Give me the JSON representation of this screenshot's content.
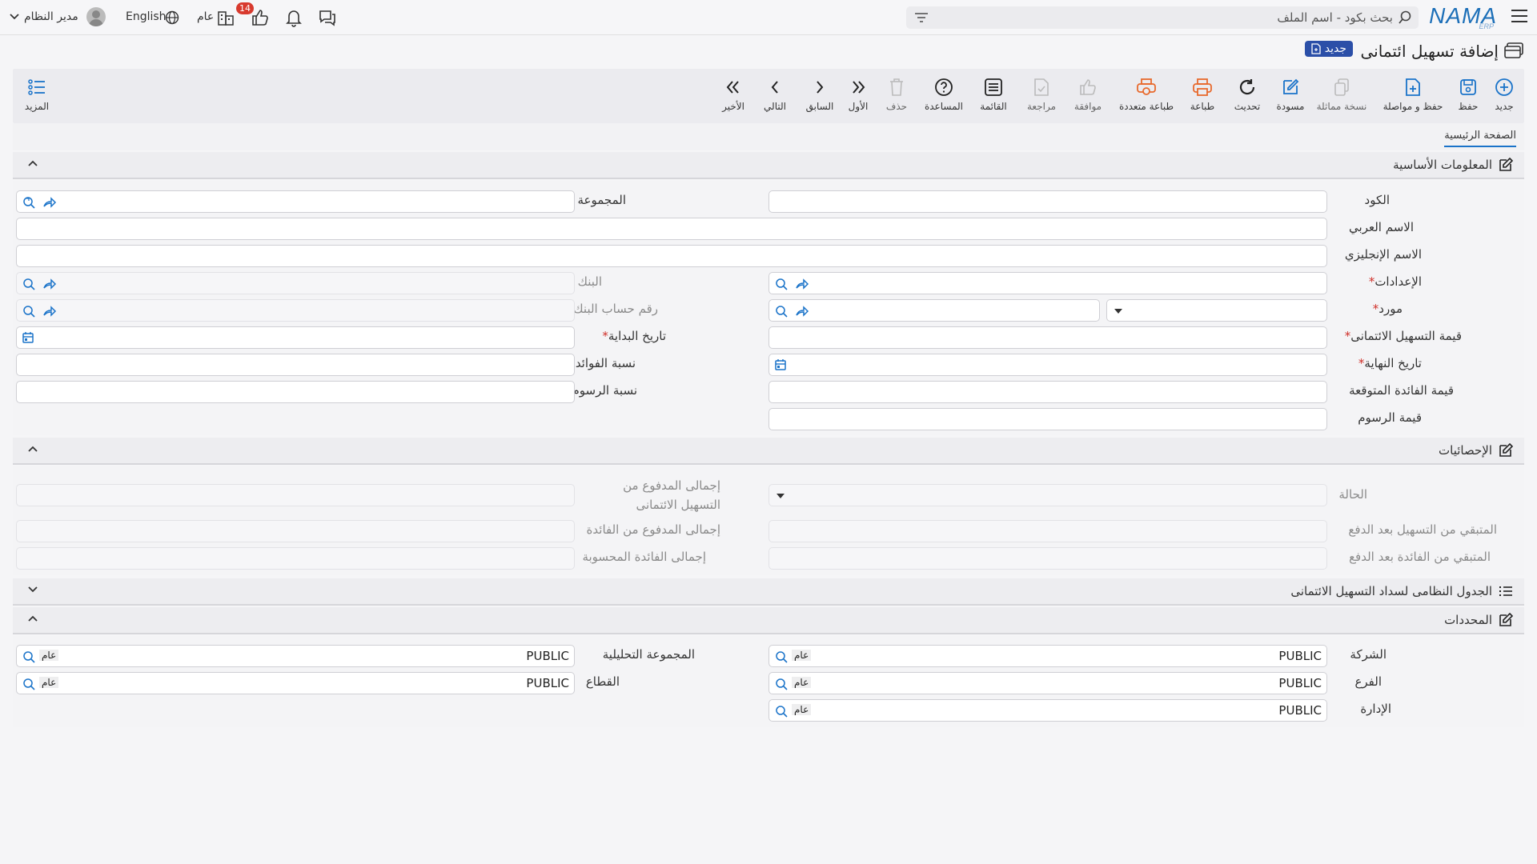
{
  "header": {
    "search_placeholder": "بحث بكود - اسم الملف",
    "brand": "NAMA",
    "brand_sub": "ERP",
    "language": "English",
    "user": "مدير النظام",
    "scope": "عام",
    "notification_count": "14"
  },
  "page": {
    "title": "إضافة تسهيل ائتمانى",
    "badge": "جديد"
  },
  "toolbar": {
    "new": "جديد",
    "save": "حفظ",
    "save_continue": "حفظ و مواصلة",
    "duplicate": "نسخة مماثلة",
    "draft": "مسودة",
    "refresh": "تحديث",
    "print": "طباعة",
    "multi_print": "طباعة متعددة",
    "approve": "موافقة",
    "review": "مراجعة",
    "list": "القائمة",
    "help": "المساعدة",
    "delete": "حذف",
    "first": "الأول",
    "previous": "السابق",
    "next": "التالي",
    "last": "الأخير",
    "more": "المزيد"
  },
  "tabs": {
    "main": "الصفحة الرئيسية"
  },
  "sections": {
    "basic": "المعلومات الأساسية",
    "stats": "الإحصائيات",
    "schedule": "الجدول النظامى لسداد التسهيل الائتمانى",
    "dimensions": "المحددات"
  },
  "basic": {
    "code": "الكود",
    "group": "المجموعة",
    "arabic_name": "الاسم العربي",
    "english_name": "الاسم الإنجليزي",
    "settings": "الإعدادات",
    "bank": "البنك",
    "supplier": "مورد",
    "bank_account": "رقم حساب البنك",
    "credit_value": "قيمة التسهيل الائتمانى",
    "start_date": "تاريخ البداية",
    "end_date": "تاريخ النهاية",
    "interest_rate": "نسبة الفوائد",
    "expected_interest": "قيمة الفائدة المتوقعة",
    "fees_rate": "نسبة الرسوم",
    "fees_value": "قيمة الرسوم"
  },
  "stats": {
    "status": "الحالة",
    "total_paid_credit": "إجمالى المدفوع من التسهيل الائتمانى",
    "remaining_credit": "المتبقي من التسهيل بعد الدفع",
    "total_paid_interest": "إجمالى المدفوع من الفائدة",
    "remaining_interest": "المتبقي من الفائدة بعد الدفع",
    "total_calc_interest": "إجمالى الفائدة المحسوبة"
  },
  "dimensions": {
    "company": "الشركة",
    "analytic_group": "المجموعة التحليلية",
    "branch": "الفرع",
    "sector": "القطاع",
    "department": "الإدارة",
    "value": "PUBLIC",
    "tag": "عام"
  },
  "colors": {
    "brand": "#1c6fb8",
    "accent": "#1a73c9",
    "orange": "#e8692c",
    "badge": "#2b4fa8"
  }
}
